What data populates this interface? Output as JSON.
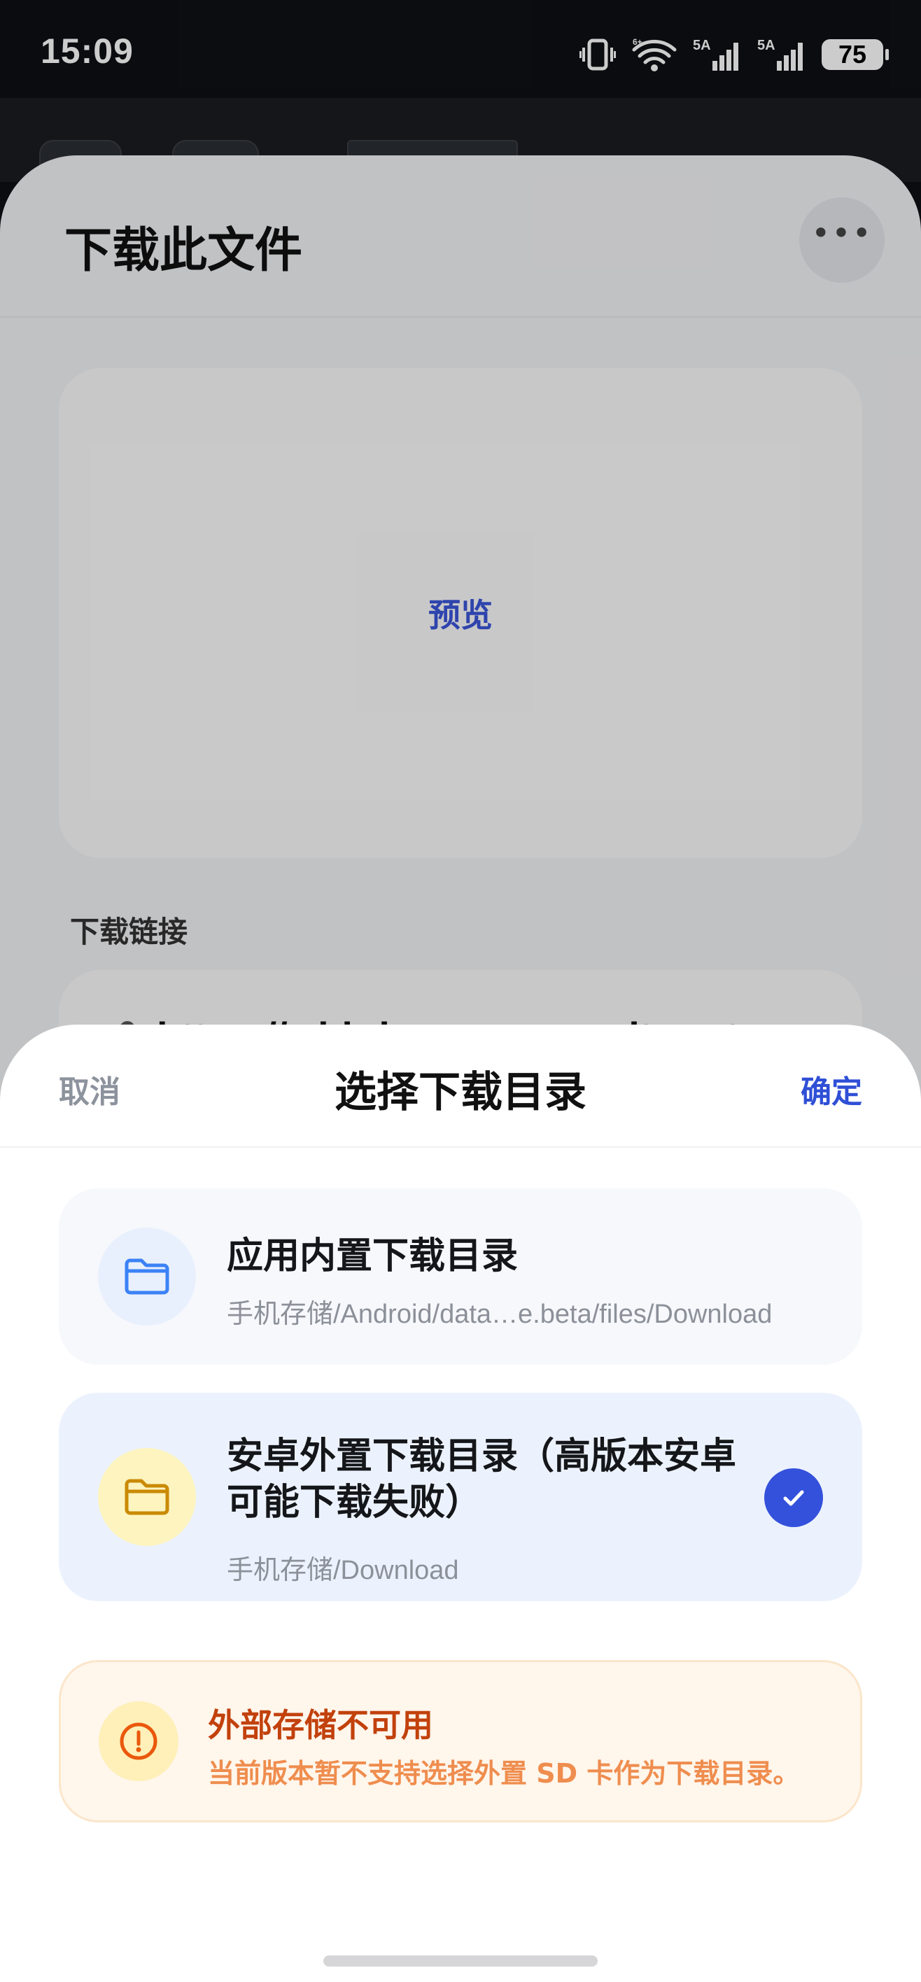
{
  "status_bar": {
    "time": "15:09",
    "battery": "75",
    "network_1": "5A",
    "network_2": "5A",
    "wifi_tag": "6+"
  },
  "download_sheet": {
    "title": "下载此文件",
    "more_icon": "more-horizontal-icon",
    "preview_label": "预览",
    "link_section_label": "下载链接",
    "link_value": "https://wbbdev.serveprositycy.top",
    "link_icon": "link-icon",
    "clear_icon": "close-icon"
  },
  "picker": {
    "cancel_label": "取消",
    "title": "选择下载目录",
    "confirm_label": "确定",
    "options": [
      {
        "title": "应用内置下载目录",
        "path": "手机存储/Android/data…e.beta/files/Download",
        "icon": "folder-icon",
        "icon_color": "#3b82f6",
        "selected": false
      },
      {
        "title": "安卓外置下载目录（高版本安卓可能下载失败）",
        "path": "手机存储/Download",
        "icon": "folder-icon",
        "icon_color": "#ca8a04",
        "selected": true
      }
    ],
    "warning": {
      "title": "外部存储不可用",
      "description": "当前版本暂不支持选择外置 SD 卡作为下载目录。",
      "icon": "alert-circle-icon",
      "color": "#c2410c"
    }
  },
  "colors": {
    "accent": "#3451dc",
    "warning_bg": "#fff6ec"
  }
}
